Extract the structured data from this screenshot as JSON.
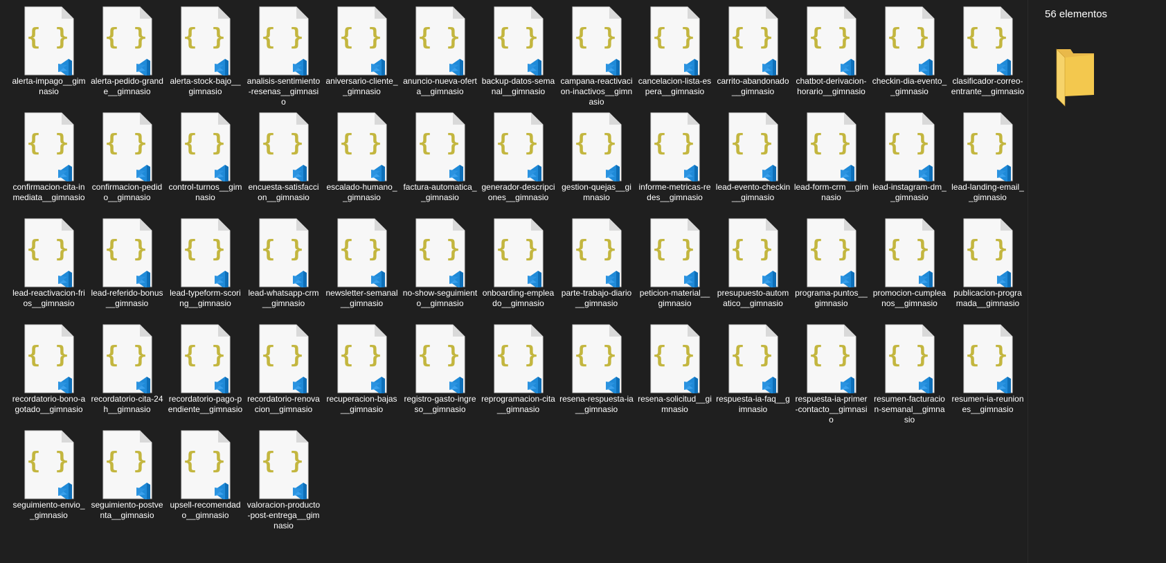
{
  "window": {
    "item_count_text": "56 elementos"
  },
  "icons": {
    "file": "json-vscode-file-icon",
    "preview": "folder-icon"
  },
  "colors": {
    "background": "#1f1f1f",
    "braces": "#c3b63f",
    "vscode_blue": "#1f8ad8",
    "folder_yellow": "#f3c84e"
  },
  "files": [
    {
      "name": "alerta-impago__gimnasio"
    },
    {
      "name": "alerta-pedido-grande__gimnasio"
    },
    {
      "name": "alerta-stock-bajo__gimnasio"
    },
    {
      "name": "analisis-sentimiento-resenas__gimnasio"
    },
    {
      "name": "aniversario-cliente__gimnasio"
    },
    {
      "name": "anuncio-nueva-oferta__gimnasio"
    },
    {
      "name": "backup-datos-semanal__gimnasio"
    },
    {
      "name": "campana-reactivacion-inactivos__gimnasio"
    },
    {
      "name": "cancelacion-lista-espera__gimnasio"
    },
    {
      "name": "carrito-abandonado__gimnasio"
    },
    {
      "name": "chatbot-derivacion-horario__gimnasio"
    },
    {
      "name": "checkin-dia-evento__gimnasio"
    },
    {
      "name": "clasificador-correo-entrante__gimnasio"
    },
    {
      "name": "confirmacion-cita-inmediata__gimnasio"
    },
    {
      "name": "confirmacion-pedido__gimnasio"
    },
    {
      "name": "control-turnos__gimnasio"
    },
    {
      "name": "encuesta-satisfaccion__gimnasio"
    },
    {
      "name": "escalado-humano__gimnasio"
    },
    {
      "name": "factura-automatica__gimnasio"
    },
    {
      "name": "generador-descripciones__gimnasio"
    },
    {
      "name": "gestion-quejas__gimnasio"
    },
    {
      "name": "informe-metricas-redes__gimnasio"
    },
    {
      "name": "lead-evento-checkin__gimnasio"
    },
    {
      "name": "lead-form-crm__gimnasio"
    },
    {
      "name": "lead-instagram-dm__gimnasio"
    },
    {
      "name": "lead-landing-email__gimnasio"
    },
    {
      "name": "lead-reactivacion-frios__gimnasio"
    },
    {
      "name": "lead-referido-bonus__gimnasio"
    },
    {
      "name": "lead-typeform-scoring__gimnasio"
    },
    {
      "name": "lead-whatsapp-crm__gimnasio"
    },
    {
      "name": "newsletter-semanal__gimnasio"
    },
    {
      "name": "no-show-seguimiento__gimnasio"
    },
    {
      "name": "onboarding-empleado__gimnasio"
    },
    {
      "name": "parte-trabajo-diario__gimnasio"
    },
    {
      "name": "peticion-material__gimnasio"
    },
    {
      "name": "presupuesto-automatico__gimnasio"
    },
    {
      "name": "programa-puntos__gimnasio"
    },
    {
      "name": "promocion-cumpleanos__gimnasio"
    },
    {
      "name": "publicacion-programada__gimnasio"
    },
    {
      "name": "recordatorio-bono-agotado__gimnasio"
    },
    {
      "name": "recordatorio-cita-24h__gimnasio"
    },
    {
      "name": "recordatorio-pago-pendiente__gimnasio"
    },
    {
      "name": "recordatorio-renovacion__gimnasio"
    },
    {
      "name": "recuperacion-bajas__gimnasio"
    },
    {
      "name": "registro-gasto-ingreso__gimnasio"
    },
    {
      "name": "reprogramacion-cita__gimnasio"
    },
    {
      "name": "resena-respuesta-ia__gimnasio"
    },
    {
      "name": "resena-solicitud__gimnasio"
    },
    {
      "name": "respuesta-ia-faq__gimnasio"
    },
    {
      "name": "respuesta-ia-primer-contacto__gimnasio"
    },
    {
      "name": "resumen-facturacion-semanal__gimnasio"
    },
    {
      "name": "resumen-ia-reuniones__gimnasio"
    },
    {
      "name": "seguimiento-envio__gimnasio"
    },
    {
      "name": "seguimiento-postventa__gimnasio"
    },
    {
      "name": "upsell-recomendado__gimnasio"
    },
    {
      "name": "valoracion-producto-post-entrega__gimnasio"
    }
  ]
}
